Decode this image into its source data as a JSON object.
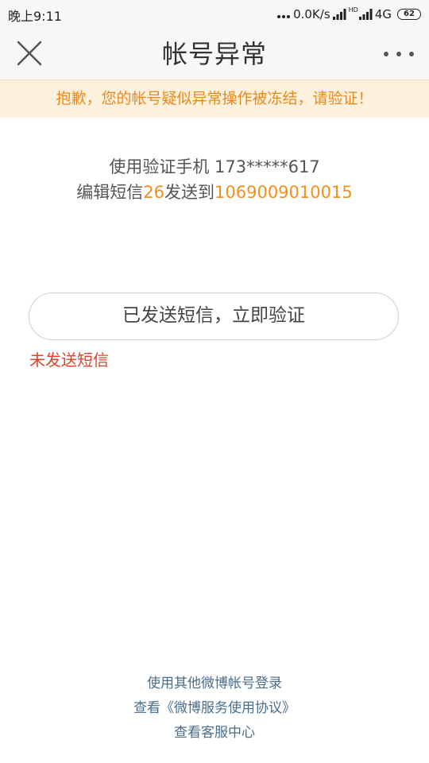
{
  "status_bar": {
    "time": "晚上9:11",
    "network_speed": "0.0K/s",
    "network_type": "4G",
    "battery": "62"
  },
  "nav": {
    "title": "帐号异常"
  },
  "banner": {
    "text": "抱歉，您的帐号疑似异常操作被冻结，请验证！"
  },
  "content": {
    "line1": "使用验证手机 173*****617",
    "line2_prefix": "编辑短信",
    "sms_code": "26",
    "line2_middle": "发送到",
    "sms_number": "1069009010015",
    "verify_button": "已发送短信，立即验证",
    "not_sent_link": "未发送短信"
  },
  "footer": {
    "links": [
      "使用其他微博帐号登录",
      "查看《微博服务使用协议》",
      "查看客服中心"
    ]
  },
  "colors": {
    "warning_bg": "#fdf0dd",
    "warning_text": "#e78a1e",
    "highlight": "#f39019",
    "error_text": "#d9442b",
    "link": "#4a6d8c"
  }
}
